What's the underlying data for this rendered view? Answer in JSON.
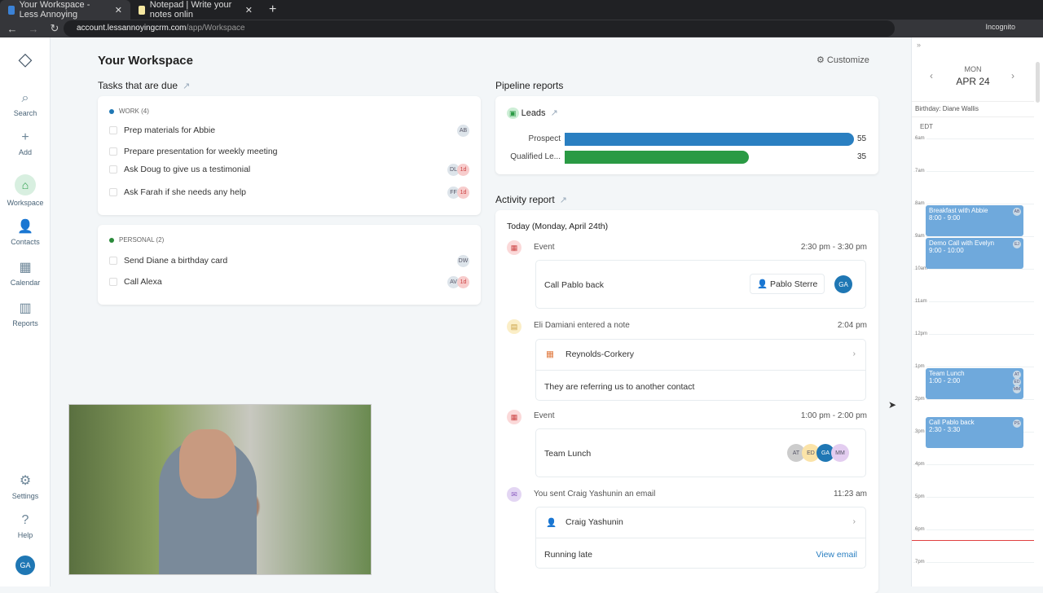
{
  "browser": {
    "tabs": [
      {
        "title": "Your Workspace - Less Annoying",
        "active": true
      },
      {
        "title": "Notepad | Write your notes onlin",
        "active": false
      }
    ],
    "url_host": "account.lessannoyingcrm.com",
    "url_path": "/app/Workspace",
    "profile": "Incognito"
  },
  "sidebar": {
    "items": [
      {
        "label": "Search",
        "icon": "search-icon"
      },
      {
        "label": "Add",
        "icon": "plus-icon"
      },
      {
        "label": "Workspace",
        "icon": "home-icon"
      },
      {
        "label": "Contacts",
        "icon": "person-icon"
      },
      {
        "label": "Calendar",
        "icon": "calendar-icon"
      },
      {
        "label": "Reports",
        "icon": "chart-icon"
      },
      {
        "label": "Settings",
        "icon": "gear-icon"
      },
      {
        "label": "Help",
        "icon": "help-icon"
      }
    ],
    "user_initials": "GA"
  },
  "page": {
    "title": "Your Workspace",
    "customize": "Customize"
  },
  "tasks": {
    "heading": "Tasks that are due",
    "groups": [
      {
        "label": "WORK (4)",
        "color": "#1f77b4",
        "items": [
          {
            "text": "Prep materials for Abbie",
            "avatar": "AB",
            "due": ""
          },
          {
            "text": "Prepare presentation for weekly meeting",
            "avatar": "",
            "due": ""
          },
          {
            "text": "Ask Doug to give us a testimonial",
            "avatar": "DL",
            "due": "1d"
          },
          {
            "text": "Ask Farah if she needs any help",
            "avatar": "FF",
            "due": "1d"
          }
        ]
      },
      {
        "label": "PERSONAL (2)",
        "color": "#2a8a3a",
        "items": [
          {
            "text": "Send Diane a birthday card",
            "avatar": "DW",
            "due": ""
          },
          {
            "text": "Call Alexa",
            "avatar": "AV",
            "due": "1d"
          }
        ]
      }
    ]
  },
  "pipeline": {
    "heading": "Pipeline reports",
    "report": "Leads",
    "max": 55,
    "bars": [
      {
        "label": "Prospect",
        "value": 55,
        "color": "#2a7fc1"
      },
      {
        "label": "Qualified Le...",
        "value": 35,
        "color": "#2a9a44"
      }
    ]
  },
  "activity": {
    "heading": "Activity report",
    "date": "Today (Monday, April 24th)",
    "items": [
      {
        "type": "Event",
        "time": "2:30 pm - 3:30 pm",
        "title": "Call Pablo back",
        "contact": "Pablo Sterre",
        "avatar": "GA"
      },
      {
        "type": "Eli Damiani entered a note",
        "time": "2:04 pm",
        "company": "Reynolds-Corkery",
        "note": "They are referring us to another contact"
      },
      {
        "type": "Event",
        "time": "1:00 pm - 2:00 pm",
        "title": "Team Lunch",
        "avatars": [
          "AT",
          "ED",
          "GA",
          "MM"
        ]
      },
      {
        "type": "You sent Craig Yashunin an email",
        "time": "11:23 am",
        "contact": "Craig Yashunin",
        "body": "Running late",
        "link": "View email"
      }
    ]
  },
  "calendar": {
    "day": "MON",
    "date": "APR 24",
    "banner": "Birthday: Diane Wallis",
    "tz": "EDT",
    "hours": [
      "6am",
      "7am",
      "8am",
      "9am",
      "10am",
      "11am",
      "12pm",
      "1pm",
      "2pm",
      "3pm",
      "4pm",
      "5pm",
      "6pm",
      "7pm"
    ],
    "events": [
      {
        "title": "Breakfast with Abbie",
        "time": "8:00 - 9:00",
        "start": 8,
        "end": 9,
        "avatars": [
          "AB"
        ]
      },
      {
        "title": "Demo Call with Evelyn",
        "time": "9:00 - 10:00",
        "start": 9,
        "end": 10,
        "avatars": [
          "EJ"
        ]
      },
      {
        "title": "Team Lunch",
        "time": "1:00 - 2:00",
        "start": 13,
        "end": 14,
        "avatars": [
          "AT",
          "ED",
          "MM"
        ]
      },
      {
        "title": "Call Pablo back",
        "time": "2:30 - 3:30",
        "start": 14.5,
        "end": 15.5,
        "avatars": [
          "PS"
        ]
      }
    ],
    "now": 18.33
  }
}
